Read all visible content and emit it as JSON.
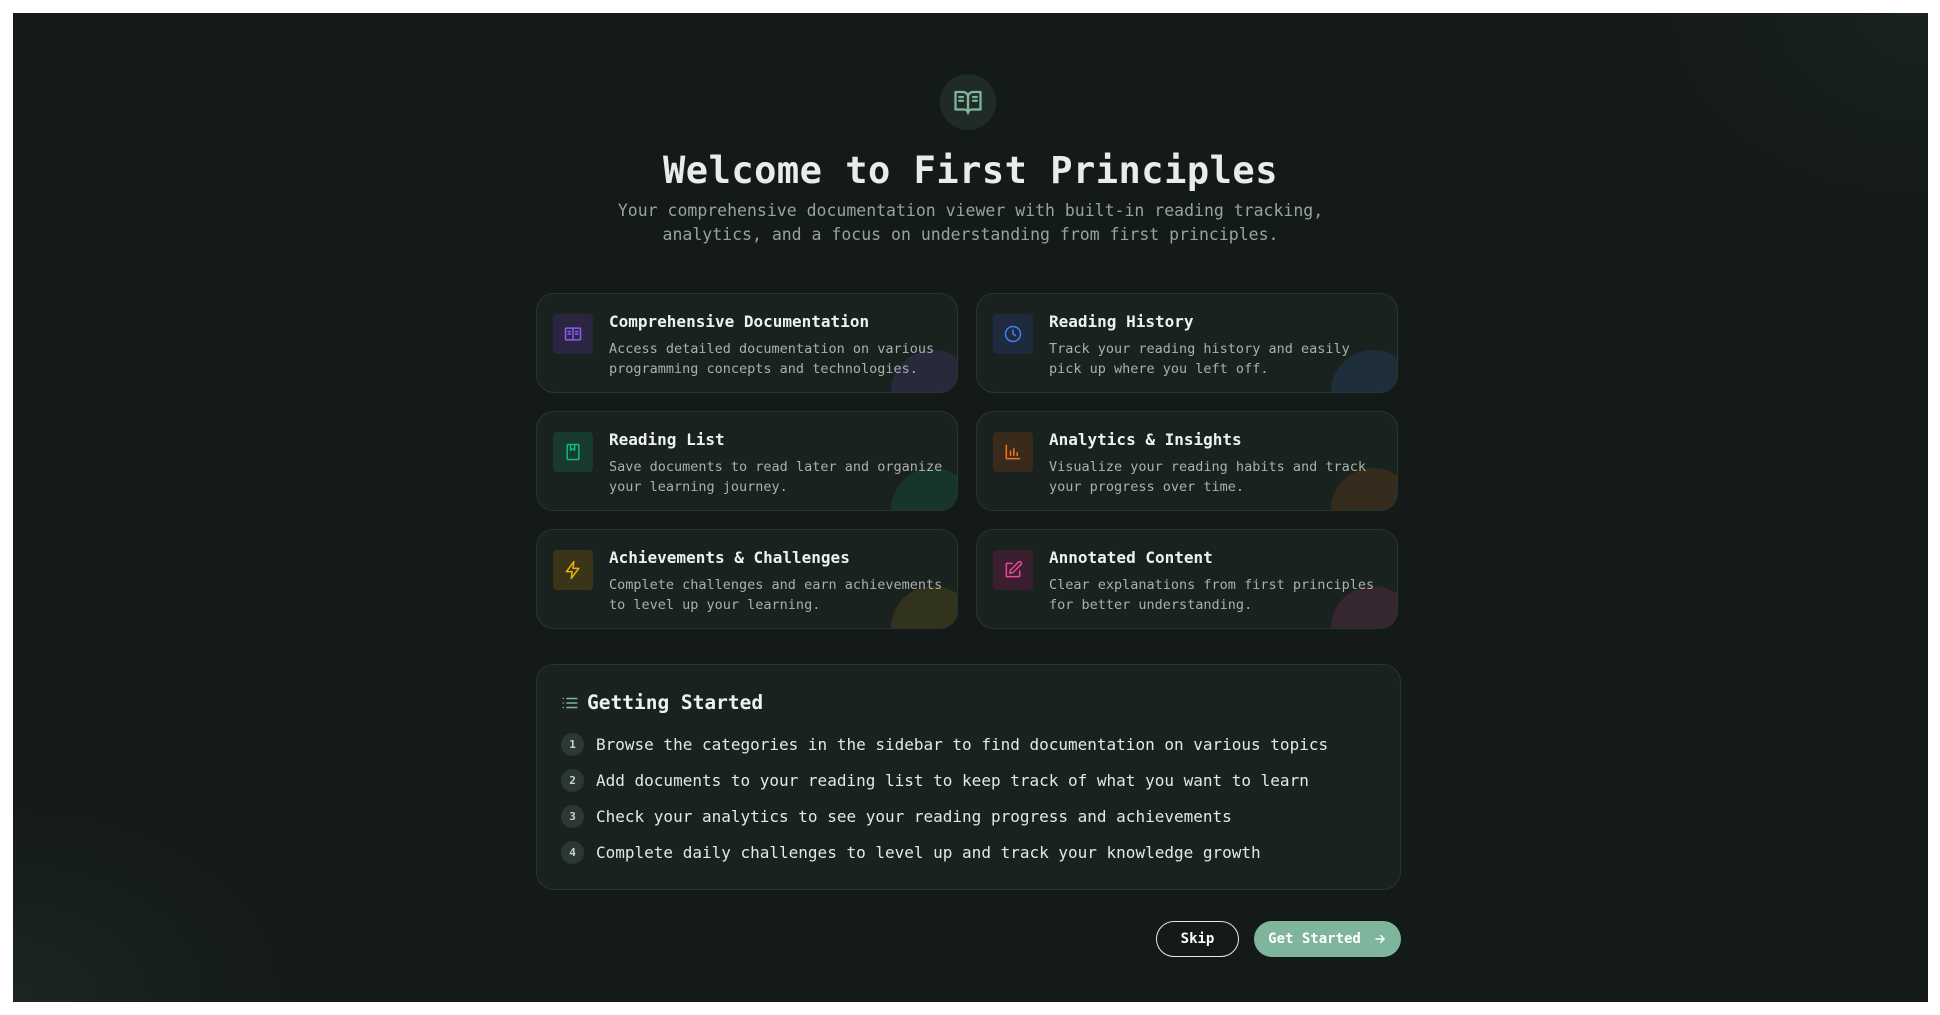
{
  "header": {
    "logo_icon": "open-book-icon",
    "title": "Welcome to First Principles",
    "subtitle": "Your comprehensive documentation viewer with built-in reading tracking, analytics, and a focus on understanding from first principles."
  },
  "features": [
    {
      "title": "Comprehensive Documentation",
      "description": "Access detailed documentation on various programming concepts and technologies.",
      "icon": "book-icon",
      "accent": "#8b5cf6"
    },
    {
      "title": "Reading History",
      "description": "Track your reading history and easily pick up where you left off.",
      "icon": "clock-icon",
      "accent": "#3b82f6"
    },
    {
      "title": "Reading List",
      "description": "Save documents to read later and organize your learning journey.",
      "icon": "bookmark-icon",
      "accent": "#10b981"
    },
    {
      "title": "Analytics & Insights",
      "description": "Visualize your reading habits and track your progress over time.",
      "icon": "bar-chart-icon",
      "accent": "#f97316"
    },
    {
      "title": "Achievements & Challenges",
      "description": "Complete challenges and earn achievements to level up your learning.",
      "icon": "lightning-icon",
      "accent": "#eab308"
    },
    {
      "title": "Annotated Content",
      "description": "Clear explanations from first principles for better understanding.",
      "icon": "edit-icon",
      "accent": "#ec4899"
    }
  ],
  "getting_started": {
    "icon": "list-icon",
    "title": "Getting Started",
    "steps": [
      {
        "num": "1",
        "text": "Browse the categories in the sidebar to find documentation on various topics"
      },
      {
        "num": "2",
        "text": "Add documents to your reading list to keep track of what you want to learn"
      },
      {
        "num": "3",
        "text": "Check your analytics to see your reading progress and achievements"
      },
      {
        "num": "4",
        "text": "Complete daily challenges to level up and track your knowledge growth"
      }
    ]
  },
  "actions": {
    "skip_label": "Skip",
    "get_started_label": "Get Started"
  },
  "colors": {
    "background": "#141a18",
    "card": "#1a2220",
    "primary": "#7fb59c"
  }
}
